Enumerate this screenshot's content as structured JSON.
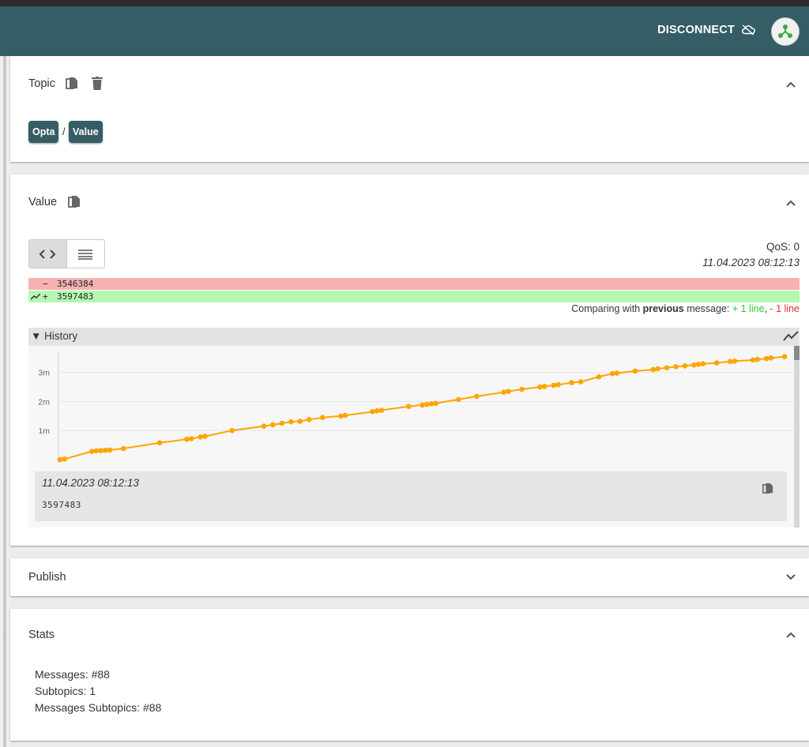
{
  "header": {
    "disconnect_label": "DISCONNECT"
  },
  "topic_panel": {
    "title": "Topic",
    "chips": [
      "Opta",
      "Value"
    ],
    "separator": "/"
  },
  "value_panel": {
    "title": "Value",
    "qos": "QoS: 0",
    "timestamp": "11.04.2023 08:12:13",
    "diff": {
      "removed_sign": "−",
      "removed_value": "3546384",
      "added_sign": "+",
      "added_value": "3597483"
    },
    "compare": {
      "prefix": "Comparing with ",
      "bold": "previous",
      "middle": " message: ",
      "added": "+ 1 line",
      "comma": ", ",
      "removed": "- 1 line"
    },
    "history": {
      "label": "▼ History",
      "selected_timestamp": "11.04.2023 08:12:13",
      "selected_value": "3597483"
    }
  },
  "publish_panel": {
    "title": "Publish"
  },
  "stats_panel": {
    "title": "Stats",
    "messages": "Messages: #88",
    "subtopics": "Subtopics: 1",
    "messages_subtopics": "Messages Subtopics: #88"
  },
  "colors": {
    "appbar": "#355d66",
    "chip": "#355d66",
    "line": "#ffa500",
    "diff_removed": "#f8b1b1",
    "diff_added": "#b4f8b1"
  },
  "chart_data": {
    "type": "line",
    "ytick_labels": [
      "1m",
      "2m",
      "3m"
    ],
    "yticks": [
      1000000,
      2000000,
      3000000
    ],
    "ylim": [
      0,
      3700000
    ],
    "x": [
      0,
      1,
      7,
      8,
      9,
      10,
      11,
      14,
      22,
      28,
      29,
      31,
      32,
      38,
      45,
      47,
      49,
      51,
      53,
      55,
      58,
      62,
      63,
      69,
      70,
      71,
      77,
      80,
      81,
      82,
      83,
      88,
      92,
      98,
      99,
      102,
      106,
      107,
      109,
      110,
      113,
      115,
      119,
      122,
      123,
      127,
      131,
      132,
      134,
      136,
      138,
      140,
      141,
      142,
      145,
      148,
      149,
      153,
      154,
      156,
      157,
      160
    ],
    "values": [
      0,
      20000,
      280000,
      300000,
      310000,
      320000,
      330000,
      380000,
      580000,
      700000,
      720000,
      780000,
      800000,
      1000000,
      1150000,
      1200000,
      1250000,
      1300000,
      1320000,
      1380000,
      1450000,
      1500000,
      1520000,
      1650000,
      1680000,
      1700000,
      1830000,
      1880000,
      1900000,
      1920000,
      1940000,
      2070000,
      2180000,
      2320000,
      2350000,
      2420000,
      2500000,
      2520000,
      2560000,
      2580000,
      2650000,
      2680000,
      2850000,
      2960000,
      2980000,
      3050000,
      3100000,
      3130000,
      3160000,
      3200000,
      3230000,
      3260000,
      3280000,
      3300000,
      3330000,
      3380000,
      3390000,
      3430000,
      3450000,
      3480000,
      3500000,
      3546384
    ]
  },
  "icons": [
    "cloud-off-icon",
    "network-icon",
    "copy-icon",
    "delete-icon",
    "chevron-up-icon",
    "chevron-down-icon",
    "code-icon",
    "list-icon",
    "trend-icon"
  ]
}
